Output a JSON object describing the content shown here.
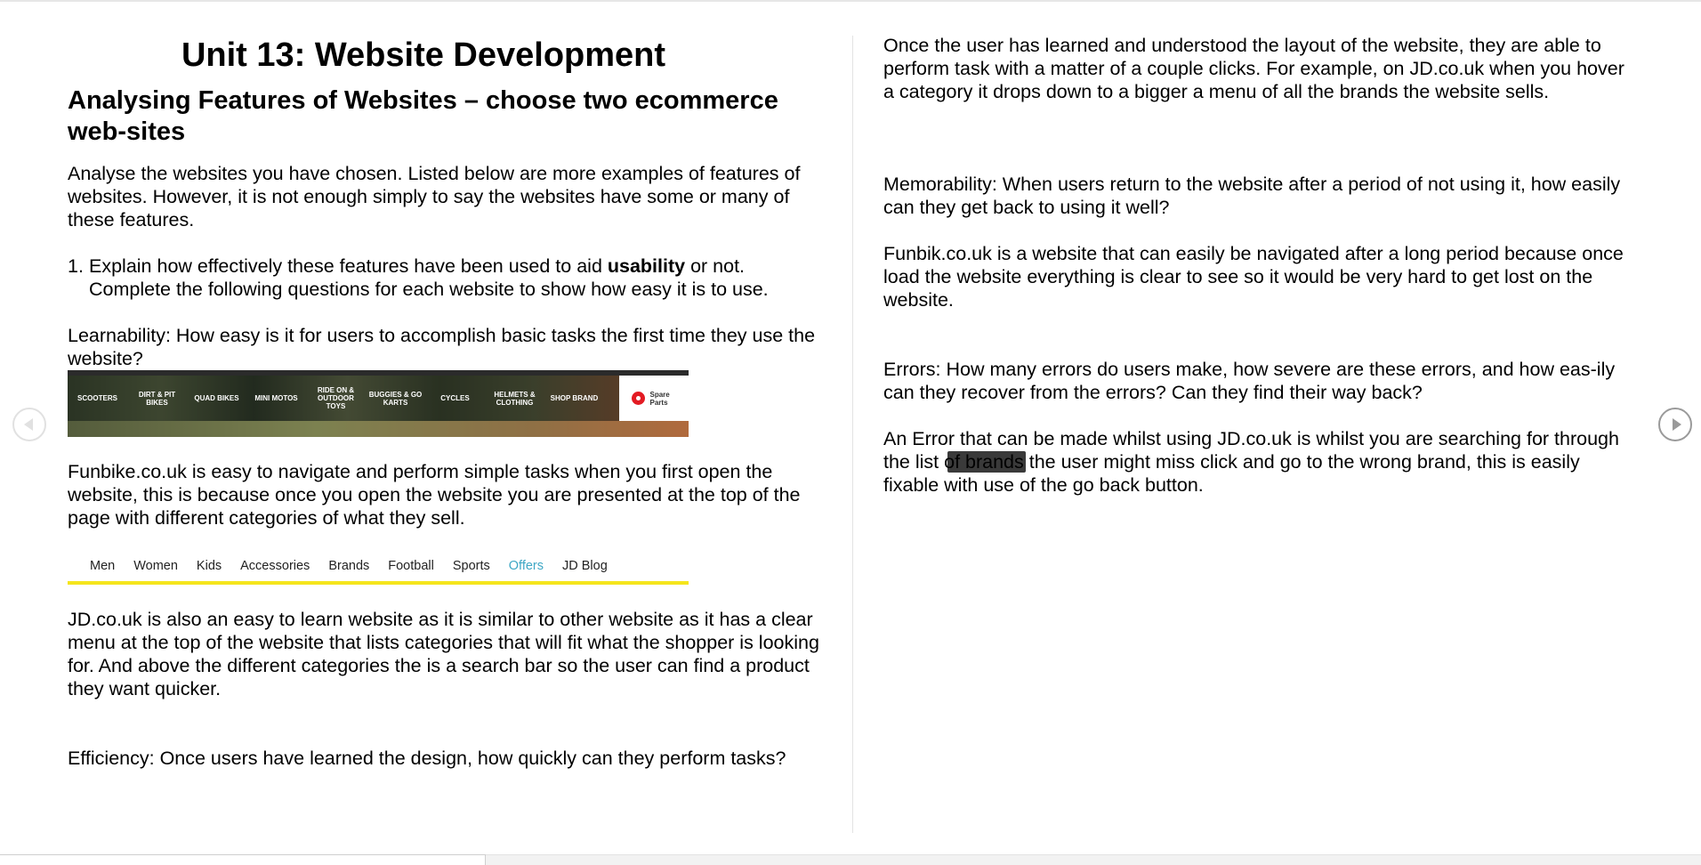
{
  "left_page": {
    "title": "Unit 13: Website Development",
    "subtitle": "Analysing Features of Websites – choose two ecommerce web-sites",
    "intro": "Analyse the websites you have chosen. Listed below are more examples of features of websites. However, it is not enough simply to say the websites have some or many of these features.",
    "list_item": {
      "number": "1.",
      "before_bold": "Explain how effectively these features have been used to aid ",
      "bold": "usability",
      "after_bold": " or not. Complete the following questions for each website to show how easy it is to use."
    },
    "learnability_question": "Learnability: How easy is it for users to accomplish basic tasks the first time they use the website?",
    "funbike_nav": {
      "items": [
        "Scooters",
        "Dirt & Pit Bikes",
        "Quad Bikes",
        "Mini Motos",
        "Ride On & Outdoor Toys",
        "Buggies & Go Karts",
        "Cycles",
        "Helmets & Clothing",
        "Shop Brand"
      ],
      "spare_parts": "Spare Parts"
    },
    "funbike_paragraph": "Funbike.co.uk is easy to navigate and perform simple tasks when you first open the website, this is because once you open the website you are presented at the top of the page with different categories of what they sell.",
    "jd_nav": {
      "links": [
        "Men",
        "Women",
        "Kids",
        "Accessories",
        "Brands",
        "Football",
        "Sports",
        "Offers",
        "JD Blog"
      ],
      "highlight_color": "#3ea7c5",
      "bar_color": "#f5e51c"
    },
    "jd_paragraph": "JD.co.uk is also an easy to learn website as it is similar to other website as it has a clear menu at the top of the website that lists categories that will fit what the shopper is looking for. And above the different categories the is a search bar so the user can find a product they want quicker.",
    "efficiency_question": "Efficiency: Once users have learned the design, how quickly can they perform tasks?"
  },
  "right_page": {
    "efficiency_answer": "Once the user has learned and understood the layout of the website, they are able to perform task with a matter of a couple clicks. For example, on JD.co.uk when you hover a category it drops down to a bigger a menu of all the brands the website sells.",
    "memorability_question": "Memorability: When users return to the website after a period of not using it, how easily can they get back to using it well?",
    "memorability_answer": "Funbik.co.uk is a website that can easily be navigated after a long period because once load the website everything is clear to see so it would be very hard to get lost on the website.",
    "errors_question": "Errors: How many errors do users make, how severe are these errors, and how eas-ily can they recover from the errors? Can they find their way back?",
    "errors_answer_part1": "An Error that can be made whilst using JD.co.uk is whilst you are searching for through the list of brands the user might miss click and go to the wrong brand, this is easily fixable with use of the go back button."
  },
  "navigation": {
    "prev_icon": "chevron-left-icon",
    "next_icon": "chevron-right-icon"
  }
}
